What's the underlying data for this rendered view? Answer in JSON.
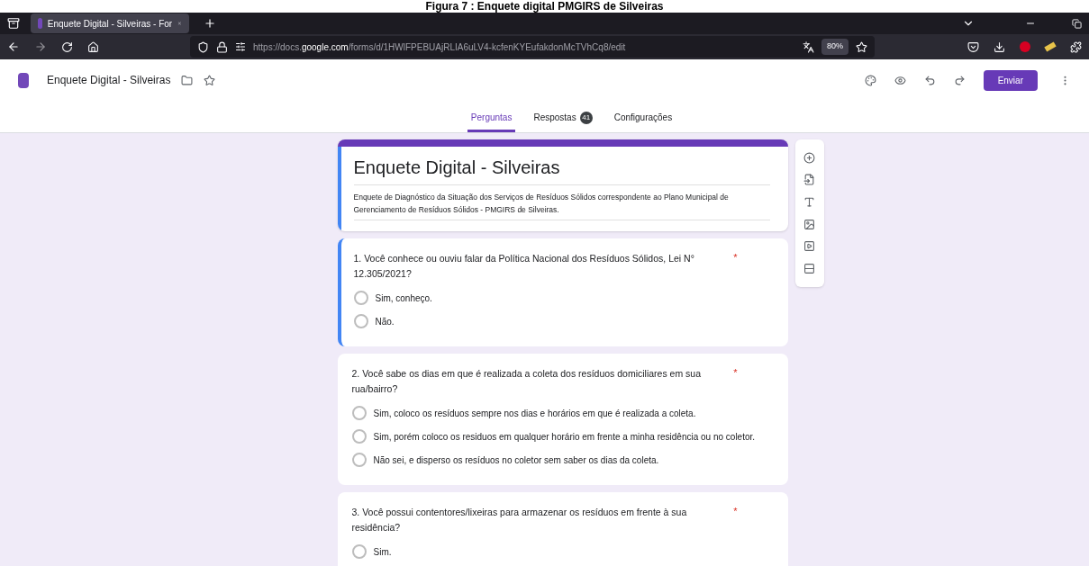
{
  "caption": "Figura 7 : Enquete digital PMGIRS de Silveiras",
  "browser": {
    "tab_title": "Enquete Digital - Silveiras - For",
    "url_host_prefix": "https://docs.",
    "url_host": "google.com",
    "url_path": "/forms/d/1HWlFPEBUAjRLIA6uLV4-kcfenKYEufakdonMcTVhCq8/edit",
    "zoom": "80%"
  },
  "app": {
    "doc_title": "Enquete Digital - Silveiras",
    "send_label": "Enviar"
  },
  "tabs": [
    {
      "label": "Perguntas",
      "selected": true
    },
    {
      "label": "Respostas",
      "selected": false,
      "badge": "41"
    },
    {
      "label": "Configurações",
      "selected": false
    }
  ],
  "form": {
    "title": "Enquete Digital - Silveiras",
    "description": "Enquete de Diagnóstico da Situação dos Serviços de Resíduos Sólidos correspondente ao Plano Municipal de Gerenciamento de Resíduos Sólidos - PMGIRS de Silveiras."
  },
  "questions": [
    {
      "text": "1. Você conhece ou ouviu falar da Política Nacional dos Resíduos Sólidos, Lei N° 12.305/2021?",
      "required_mark": "*",
      "focused": true,
      "options": [
        {
          "label": "Sim, conheço.",
          "selected": false
        },
        {
          "label": "Não.",
          "selected": false
        }
      ]
    },
    {
      "text": "2. Você sabe os dias em que é realizada a coleta dos resíduos domiciliares em sua rua/bairro?",
      "required_mark": "*",
      "focused": false,
      "options": [
        {
          "label": "Sim, coloco os resíduos sempre nos dias e horários em que é realizada a coleta.",
          "selected": false
        },
        {
          "label": "Sim, porém coloco os residuos em qualquer horário em frente a minha residência ou no coletor.",
          "selected": false
        },
        {
          "label": "Não sei, e disperso os resíduos no coletor sem saber os dias da coleta.",
          "selected": false
        }
      ]
    },
    {
      "text": "3. Você possui contentores/lixeiras para armazenar os resíduos em frente à sua  residência?",
      "required_mark": "*",
      "focused": false,
      "options": [
        {
          "label": "Sim.",
          "selected": false
        }
      ]
    }
  ]
}
